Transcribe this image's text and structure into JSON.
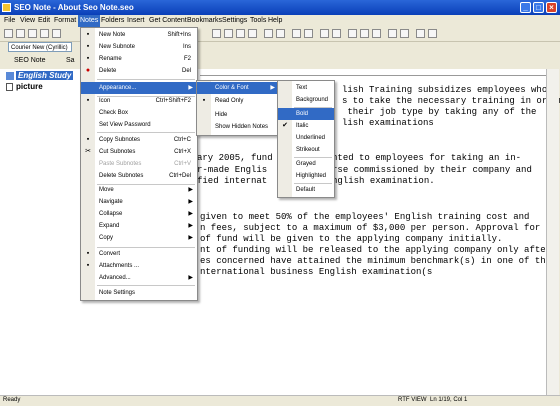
{
  "window": {
    "title": "SEO Note - About Seo Note.seo"
  },
  "menubar": [
    "File",
    "View",
    "Edit",
    "Format",
    "Notes",
    "Folders",
    "Insert",
    "Get Content",
    "Bookmarks",
    "Settings",
    "Tools",
    "Help"
  ],
  "toolbar": {
    "font": "Courier New (Cyrillic)"
  },
  "tabs": [
    "SEO Note",
    "Sa"
  ],
  "tree": {
    "node1": "English Study",
    "node2": "picture"
  },
  "editor": {
    "lines": [
      "lish Training subsidizes employees who",
      "s to take the necessary training in order",
      " their job type by taking any of the",
      "lish examinations",
      "",
      "ary 2005, fund        granted to employees for taking an in-",
      "r-made Englis         course commissioned by their company and",
      "fied internat        ss English examination.",
      "",
      "given to meet 50% of the employees' English training cost and",
      "n fees, subject to a maximum of $3,000 per person. Approval for",
      "of fund will be given to the applying company initially.",
      "nt of funding will be released to the applying company only after",
      "es concerned have attained the minimum benchmark(s) in one of the",
      "nternational business English examination(s"
    ]
  },
  "notes_menu": [
    {
      "label": "New Note",
      "shortcut": "Shift+Ins"
    },
    {
      "label": "New Subnote",
      "shortcut": "Ins"
    },
    {
      "label": "Rename",
      "shortcut": "F2"
    },
    {
      "label": "Delete",
      "shortcut": "Del"
    },
    {
      "label": "Appearance...",
      "shortcut": ""
    },
    {
      "label": "Icon",
      "shortcut": "Ctrl+Shift+F2"
    },
    {
      "label": "Check Box",
      "shortcut": ""
    },
    {
      "label": "Set View Password",
      "shortcut": ""
    },
    {
      "label": "Copy Subnotes",
      "shortcut": "Ctrl+C"
    },
    {
      "label": "Cut Subnotes",
      "shortcut": "Ctrl+X"
    },
    {
      "label": "Paste Subnotes",
      "shortcut": "Ctrl+V"
    },
    {
      "label": "Delete Subnotes",
      "shortcut": "Ctrl+Del"
    },
    {
      "label": "Move",
      "shortcut": ""
    },
    {
      "label": "Navigate",
      "shortcut": ""
    },
    {
      "label": "Collapse",
      "shortcut": ""
    },
    {
      "label": "Expand",
      "shortcut": ""
    },
    {
      "label": "Copy",
      "shortcut": ""
    },
    {
      "label": "Convert",
      "shortcut": ""
    },
    {
      "label": "Attachments ...",
      "shortcut": ""
    },
    {
      "label": "Advanced...",
      "shortcut": ""
    },
    {
      "label": "Note Settings",
      "shortcut": ""
    }
  ],
  "appearance_menu": [
    "Color & Font",
    "Read Only",
    "Hide",
    "Show Hidden Notes"
  ],
  "color_font_menu": [
    "Text",
    "Background",
    "Bold",
    "Italic",
    "Underlined",
    "Strikeout",
    "Grayed",
    "Highlighted",
    "Default"
  ],
  "status": {
    "left": "Ready",
    "mode": "RTF VIEW",
    "position": "Ln 1/19, Col 1"
  }
}
